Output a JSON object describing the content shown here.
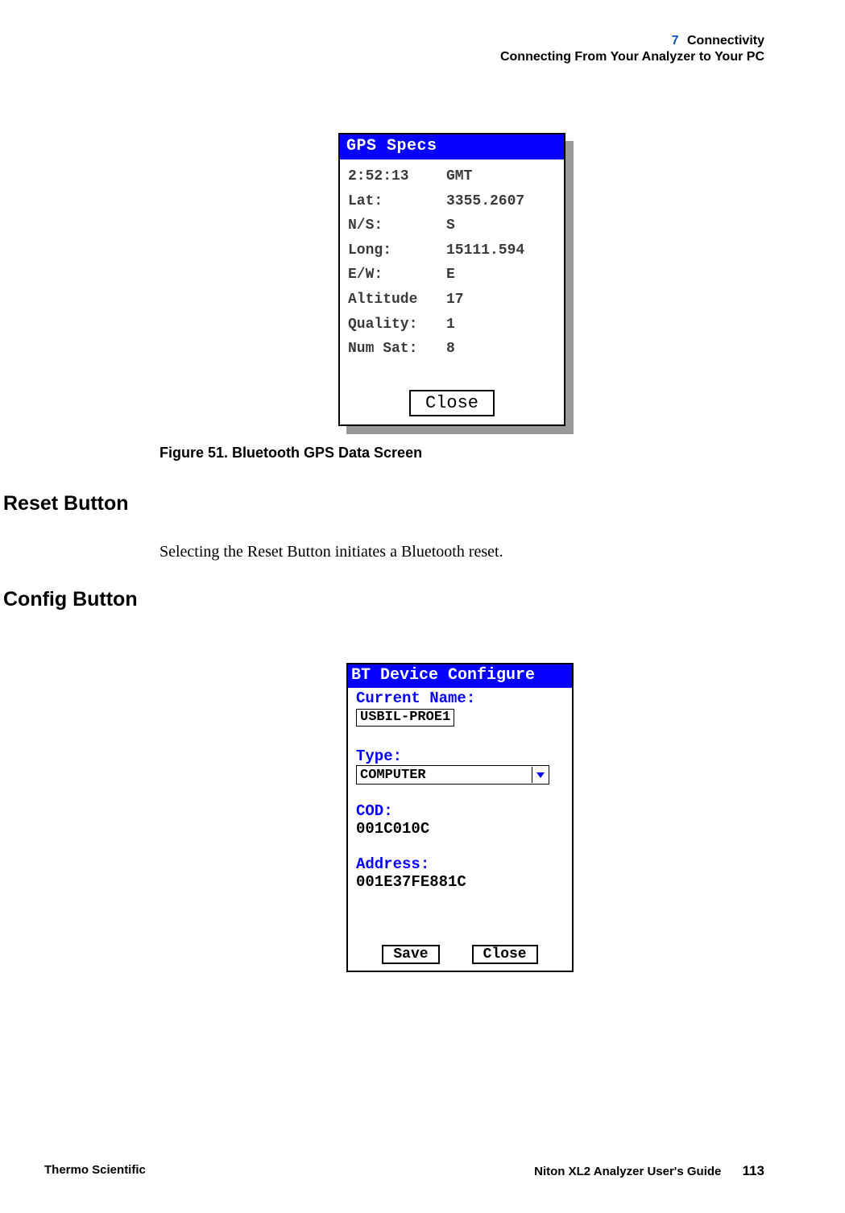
{
  "header": {
    "chapter_num": "7",
    "chapter_title": "Connectivity",
    "section": "Connecting From Your Analyzer to Your PC"
  },
  "gps": {
    "title": "GPS Specs",
    "rows": [
      {
        "label": "2:52:13",
        "value": "GMT"
      },
      {
        "label": "Lat:",
        "value": "3355.2607"
      },
      {
        "label": "N/S:",
        "value": "S"
      },
      {
        "label": "Long:",
        "value": "15111.594"
      },
      {
        "label": "E/W:",
        "value": "E"
      },
      {
        "label": "Altitude",
        "value": "17"
      },
      {
        "label": "Quality:",
        "value": "1"
      },
      {
        "label": "Num Sat:",
        "value": "8"
      }
    ],
    "close": "Close"
  },
  "fig_caption": "Figure 51.   Bluetooth GPS Data Screen",
  "headings": {
    "reset": "Reset Button",
    "config": "Config Button"
  },
  "paragraphs": {
    "reset": "Selecting the Reset Button initiates a Bluetooth reset."
  },
  "bt": {
    "title": "BT Device Configure",
    "labels": {
      "current_name": "Current Name:",
      "type": "Type:",
      "cod": "COD:",
      "address": "Address:"
    },
    "current_name_value": "USBIL-PROE1",
    "type_value": "COMPUTER",
    "cod_value": "001C010C",
    "address_value": "001E37FE881C",
    "save": "Save",
    "close": "Close"
  },
  "footer": {
    "left": "Thermo Scientific",
    "guide": "Niton XL2 Analyzer User's Guide",
    "page": "113"
  }
}
